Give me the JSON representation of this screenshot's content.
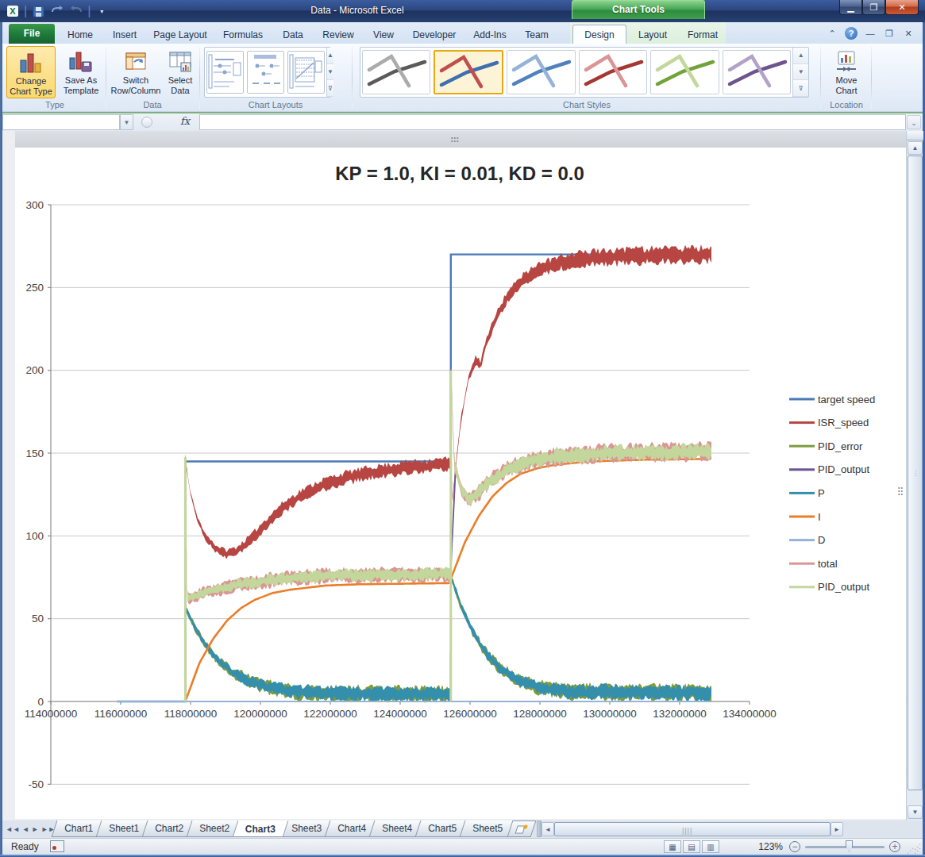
{
  "titlebar": {
    "title": "Data - Microsoft Excel",
    "context_group": "Chart Tools"
  },
  "tabs": {
    "file": "File",
    "main": [
      "Home",
      "Insert",
      "Page Layout",
      "Formulas",
      "Data",
      "Review",
      "View",
      "Developer",
      "Add-Ins",
      "Team"
    ],
    "contextual": [
      "Design",
      "Layout",
      "Format"
    ],
    "active": "Design"
  },
  "ribbon": {
    "type_group": {
      "label": "Type",
      "change_chart_type": "Change Chart Type",
      "save_as_template": "Save As Template"
    },
    "data_group": {
      "label": "Data",
      "switch_row_column": "Switch Row/Column",
      "select_data": "Select Data"
    },
    "layouts_group": {
      "label": "Chart Layouts"
    },
    "styles_group": {
      "label": "Chart Styles",
      "selected_index": 1,
      "styles": [
        {
          "c1": "#5A5A5A",
          "c2": "#ABABAB"
        },
        {
          "c1": "#3F6FAF",
          "c2": "#C0504D"
        },
        {
          "c1": "#4F81BD",
          "c2": "#95B3D7"
        },
        {
          "c1": "#A33835",
          "c2": "#D99694"
        },
        {
          "c1": "#71A33B",
          "c2": "#C3D69B"
        },
        {
          "c1": "#6E548E",
          "c2": "#B3A2C7"
        }
      ]
    },
    "location_group": {
      "label": "Location",
      "move_chart": "Move Chart"
    }
  },
  "formula_bar": {
    "fx_label": "fx"
  },
  "sheet_tabs": {
    "tabs": [
      "Chart1",
      "Sheet1",
      "Chart2",
      "Sheet2",
      "Chart3",
      "Sheet3",
      "Chart4",
      "Sheet4",
      "Chart5",
      "Sheet5"
    ],
    "active": "Chart3"
  },
  "status_bar": {
    "ready": "Ready",
    "zoom_level": "123%"
  },
  "chart_data": {
    "type": "line",
    "title": "KP = 1.0, KI = 0.01, KD = 0.0",
    "x_axis": {
      "min": 114000000,
      "max": 134000000,
      "tick_step": 2000000,
      "labels": [
        "114000000",
        "116000000",
        "118000000",
        "120000000",
        "122000000",
        "124000000",
        "126000000",
        "128000000",
        "130000000",
        "132000000",
        "134000000"
      ]
    },
    "y_axis": {
      "min": -50,
      "max": 300,
      "tick_step": 50,
      "labels": [
        300,
        250,
        200,
        150,
        100,
        50,
        0,
        -50
      ]
    },
    "grid": true,
    "legend_position": "right",
    "events": {
      "data_start_M": 115.9,
      "step1_M": 117.85,
      "step1_target": 145,
      "step2_M": 125.45,
      "step2_target": 270,
      "data_end_M": 132.9
    },
    "series": [
      {
        "name": "target speed",
        "color": "#4A7AB5",
        "type": "step",
        "points_M": [
          [
            115.9,
            0
          ],
          [
            117.85,
            0
          ],
          [
            117.85,
            145
          ],
          [
            125.45,
            145
          ],
          [
            125.45,
            270
          ],
          [
            132.9,
            270
          ]
        ]
      },
      {
        "name": "ISR_speed",
        "color": "#B74542",
        "type": "noisy",
        "segments": [
          {
            "t0": 117.85,
            "t1": 125.45,
            "keys": [
              [
                0,
                148
              ],
              [
                0.15,
                126
              ],
              [
                0.35,
                110
              ],
              [
                0.6,
                99
              ],
              [
                0.9,
                92
              ],
              [
                1.2,
                89
              ],
              [
                1.5,
                91
              ],
              [
                1.9,
                98
              ],
              [
                2.3,
                107
              ],
              [
                2.8,
                117
              ],
              [
                3.3,
                124
              ],
              [
                3.9,
                130.5
              ],
              [
                4.6,
                135
              ],
              [
                5.4,
                138.5
              ],
              [
                6.4,
                141.5
              ],
              [
                7.6,
                143.5
              ]
            ],
            "hw": [
              [
                0,
                1.3
              ],
              [
                0.4,
                2.2
              ],
              [
                1,
                3.2
              ],
              [
                2,
                4.2
              ],
              [
                3.5,
                4.8
              ],
              [
                5,
                5
              ],
              [
                7.6,
                5
              ]
            ]
          },
          {
            "t0": 125.45,
            "t1": 132.9,
            "keys": [
              [
                0,
                150
              ],
              [
                0.04,
                121
              ],
              [
                0.15,
                145
              ],
              [
                0.3,
                172
              ],
              [
                0.5,
                195
              ],
              [
                0.7,
                206
              ],
              [
                0.85,
                203
              ],
              [
                1.0,
                216
              ],
              [
                1.25,
                230
              ],
              [
                1.55,
                242
              ],
              [
                1.95,
                253
              ],
              [
                2.45,
                260
              ],
              [
                3.0,
                264.5
              ],
              [
                3.6,
                267
              ],
              [
                4.5,
                268.5
              ],
              [
                6.0,
                269.5
              ],
              [
                7.45,
                270
              ]
            ],
            "hw": [
              [
                0,
                2.2
              ],
              [
                0.5,
                3.2
              ],
              [
                1.5,
                4.6
              ],
              [
                3,
                5.6
              ],
              [
                4.5,
                6.3
              ],
              [
                7.45,
                6.3
              ]
            ]
          }
        ]
      },
      {
        "name": "PID_error",
        "color": "#7E9B3E",
        "type": "noisy_under",
        "under_of": "P",
        "extra_hw": 0.7
      },
      {
        "name": "PID_output",
        "color": "#6A5292",
        "type": "centerline",
        "of": "PID_output2"
      },
      {
        "name": "P",
        "color": "#338FAC",
        "type": "noisy",
        "segments": [
          {
            "t0": 117.85,
            "t1": 125.45,
            "keys": [
              [
                0,
                57
              ],
              [
                0.25,
                46
              ],
              [
                0.55,
                35
              ],
              [
                0.9,
                26
              ],
              [
                1.3,
                18.5
              ],
              [
                1.8,
                12.5
              ],
              [
                2.4,
                8.5
              ],
              [
                3.1,
                6
              ],
              [
                4,
                5
              ],
              [
                7.6,
                4.5
              ]
            ],
            "hw": [
              [
                0,
                1.8
              ],
              [
                0.8,
                2.8
              ],
              [
                2,
                4.2
              ],
              [
                3.5,
                4.9
              ],
              [
                7.6,
                4.9
              ]
            ]
          },
          {
            "t0": 125.45,
            "t1": 132.9,
            "keys": [
              [
                0,
                75
              ],
              [
                0.3,
                57
              ],
              [
                0.65,
                41
              ],
              [
                1.0,
                29
              ],
              [
                1.4,
                20
              ],
              [
                1.9,
                13
              ],
              [
                2.5,
                8.5
              ],
              [
                3.3,
                6
              ],
              [
                7.45,
                5
              ]
            ],
            "hw": [
              [
                0,
                2.2
              ],
              [
                1,
                3.4
              ],
              [
                2.5,
                4.6
              ],
              [
                4,
                5.2
              ],
              [
                7.45,
                5.2
              ]
            ]
          }
        ]
      },
      {
        "name": "I",
        "color": "#EA7D28",
        "type": "line",
        "segments": [
          {
            "t0": 117.85,
            "t1": 125.45,
            "keys": [
              [
                0,
                0
              ],
              [
                0.4,
                23
              ],
              [
                0.8,
                38
              ],
              [
                1.2,
                49
              ],
              [
                1.6,
                56.5
              ],
              [
                2.0,
                61.5
              ],
              [
                2.5,
                65.5
              ],
              [
                3.0,
                67.5
              ],
              [
                4,
                70
              ],
              [
                5,
                70.8
              ],
              [
                7.6,
                71.5
              ]
            ]
          },
          {
            "t0": 125.45,
            "t1": 132.9,
            "keys": [
              [
                0,
                74
              ],
              [
                0.4,
                96
              ],
              [
                0.8,
                112
              ],
              [
                1.2,
                124
              ],
              [
                1.6,
                132
              ],
              [
                2.0,
                137.5
              ],
              [
                2.5,
                141
              ],
              [
                3.0,
                143
              ],
              [
                4,
                145
              ],
              [
                5.5,
                146
              ],
              [
                7.45,
                146.5
              ]
            ]
          }
        ]
      },
      {
        "name": "D",
        "color": "#95B3D7",
        "type": "flat",
        "value": 0,
        "t0": 115.9,
        "t1": 132.9
      },
      {
        "name": "total",
        "color": "#D99694",
        "type": "noisy_under",
        "under_of": "PID_output2",
        "extra_hw": 1.0
      },
      {
        "name": "PID_output",
        "color": "#C3D69B",
        "type": "noisy",
        "id": "PID_output2",
        "segments": [
          {
            "t0": 117.85,
            "t1": 125.45,
            "keys": [
              [
                0,
                147
              ],
              [
                0.07,
                62
              ],
              [
                0.6,
                66
              ],
              [
                1.5,
                70.5
              ],
              [
                2.5,
                73.5
              ],
              [
                4,
                76
              ],
              [
                7.6,
                77
              ]
            ],
            "hw": [
              [
                0,
                2.8
              ],
              [
                0.5,
                3.4
              ],
              [
                2,
                4.2
              ],
              [
                7.6,
                4.4
              ]
            ]
          },
          {
            "t0": 125.45,
            "t1": 132.9,
            "keys": [
              [
                0,
                200
              ],
              [
                0.1,
                143
              ],
              [
                0.3,
                128
              ],
              [
                0.5,
                122
              ],
              [
                0.75,
                125
              ],
              [
                1.1,
                133
              ],
              [
                1.6,
                140
              ],
              [
                2.3,
                145.5
              ],
              [
                3.1,
                148
              ],
              [
                4.5,
                150
              ],
              [
                7.45,
                151
              ]
            ],
            "hw": [
              [
                0,
                3.5
              ],
              [
                0.8,
                4.6
              ],
              [
                3,
                5.4
              ],
              [
                7.45,
                5.6
              ]
            ]
          }
        ]
      }
    ],
    "spikes": {
      "step1_spike_top": 147.5,
      "step2_spike_top": 200,
      "pid_output_spike_bottom": 0
    }
  }
}
